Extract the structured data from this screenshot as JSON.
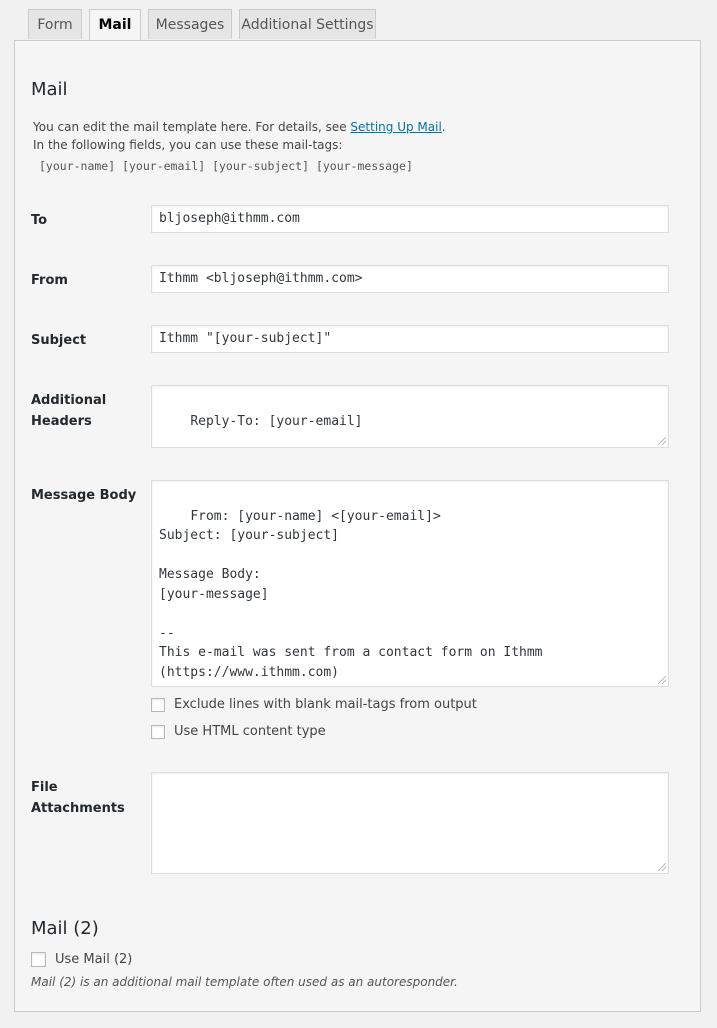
{
  "tabs": [
    {
      "label": "Form"
    },
    {
      "label": "Mail"
    },
    {
      "label": "Messages"
    },
    {
      "label": "Additional Settings"
    }
  ],
  "mail": {
    "heading": "Mail",
    "desc_line1_prefix": "You can edit the mail template here. For details, see ",
    "desc_link": "Setting Up Mail",
    "desc_line1_suffix": ".",
    "desc_line2": "In the following fields, you can use these mail-tags:",
    "mail_tags": "[your-name] [your-email] [your-subject] [your-message]",
    "to_label": "To",
    "to_value": "bljoseph@ithmm.com",
    "from_label": "From",
    "from_value": "Ithmm <bljoseph@ithmm.com>",
    "subject_label": "Subject",
    "subject_value": "Ithmm \"[your-subject]\"",
    "headers_label_line1": "Additional",
    "headers_label_line2": "Headers",
    "headers_value": "Reply-To: [your-email]",
    "body_label": "Message Body",
    "body_value": "From: [your-name] <[your-email]>\nSubject: [your-subject]\n\nMessage Body:\n[your-message]\n\n--\nThis e-mail was sent from a contact form on Ithmm\n(https://www.ithmm.com)",
    "exclude_blank_label": "Exclude lines with blank mail-tags from output",
    "html_content_label": "Use HTML content type",
    "attachments_label_line1": "File",
    "attachments_label_line2": "Attachments",
    "attachments_value": ""
  },
  "mail2": {
    "heading": "Mail (2)",
    "use_label": "Use Mail (2)",
    "note": "Mail (2) is an additional mail template often used as an autoresponder."
  }
}
